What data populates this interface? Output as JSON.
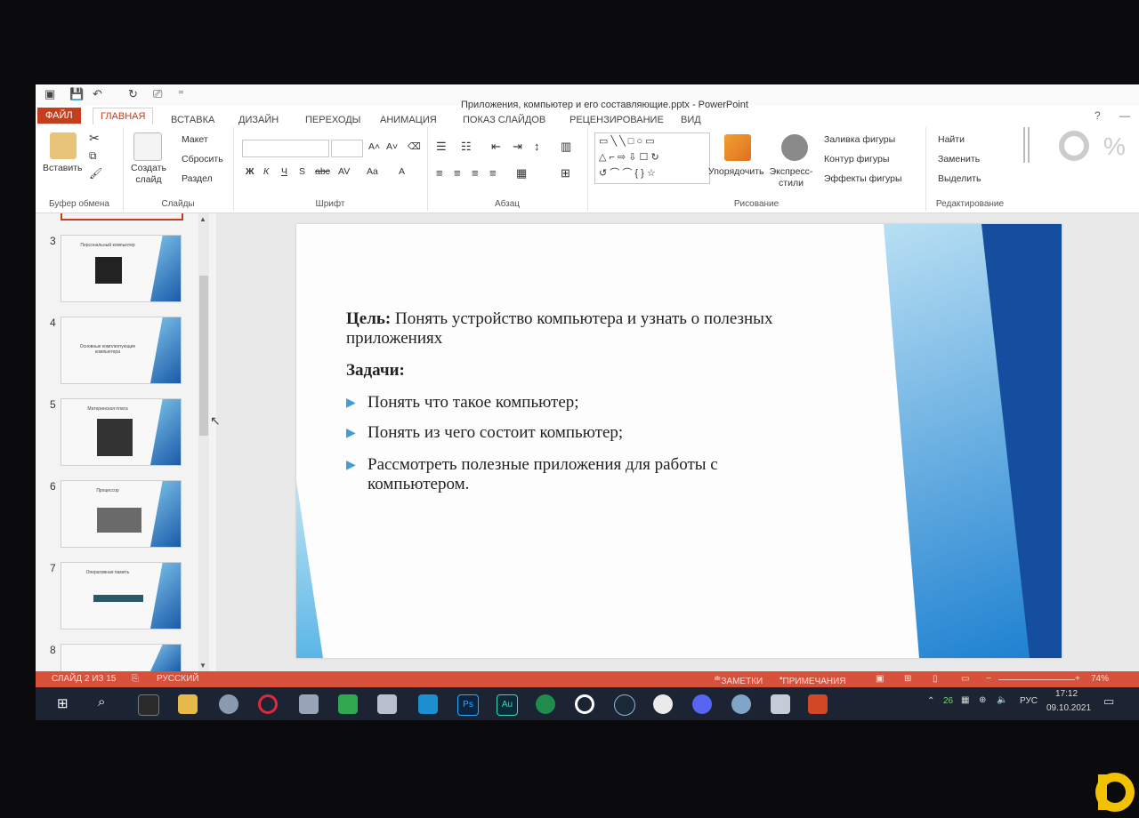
{
  "window": {
    "title": "Приложения, компьютер и его составляющие.pptx - PowerPoint",
    "help": "?"
  },
  "tabs": [
    {
      "label": "ФАЙЛ"
    },
    {
      "label": "ГЛАВНАЯ"
    },
    {
      "label": "ВСТАВКА"
    },
    {
      "label": "ДИЗАЙН"
    },
    {
      "label": "ПЕРЕХОДЫ"
    },
    {
      "label": "АНИМАЦИЯ"
    },
    {
      "label": "ПОКАЗ СЛАЙДОВ"
    },
    {
      "label": "РЕЦЕНЗИРОВАНИЕ"
    },
    {
      "label": "ВИД"
    }
  ],
  "ribbon": {
    "clipboard": {
      "paste": "Вставить",
      "group": "Буфер обмена"
    },
    "slides": {
      "new_slide": "Создать слайд",
      "layout": "Макет",
      "reset": "Сбросить",
      "section": "Раздел",
      "group": "Слайды"
    },
    "font": {
      "group": "Шрифт",
      "bold": "Ж",
      "italic": "К",
      "underline": "Ч",
      "strike": "S",
      "abc": "abc",
      "av": "AV",
      "aa": "Aa",
      "a": "A"
    },
    "paragraph": {
      "group": "Абзац"
    },
    "drawing": {
      "arrange": "Упорядочить",
      "quick_styles": "Экспресс-стили",
      "fill": "Заливка фигуры",
      "outline": "Контур фигуры",
      "effects": "Эффекты фигуры",
      "group": "Рисование"
    },
    "editing": {
      "find": "Найти",
      "replace": "Заменить",
      "select": "Выделить",
      "group": "Редактирование"
    }
  },
  "thumbnails": [
    {
      "num": "3",
      "title": "Персональный компьютер"
    },
    {
      "num": "4",
      "title": "Основные комплектующие компьютера"
    },
    {
      "num": "5",
      "title": "Материнская плата"
    },
    {
      "num": "6",
      "title": "Процессор"
    },
    {
      "num": "7",
      "title": "Оперативная память"
    },
    {
      "num": "8",
      "title": ""
    }
  ],
  "slide": {
    "goal_label": "Цель:",
    "goal_text": "Понять устройство компьютера и узнать о полезных приложениях",
    "tasks_label": "Задачи:",
    "tasks": [
      "Понять что такое компьютер;",
      "Понять из чего состоит компьютер;",
      "Рассмотреть полезные приложения для работы с компьютером."
    ]
  },
  "status": {
    "slide_info": "СЛАЙД 2 ИЗ 15",
    "language": "РУССКИЙ",
    "notes": "ЗАМЕТКИ",
    "comments": "ПРИМЕЧАНИЯ",
    "zoom": "74%"
  },
  "taskbar": {
    "time": "17:12",
    "date": "09.10.2021",
    "lang": "РУС",
    "temp": "26",
    "ps_label": "Ps",
    "au_label": "Au"
  }
}
